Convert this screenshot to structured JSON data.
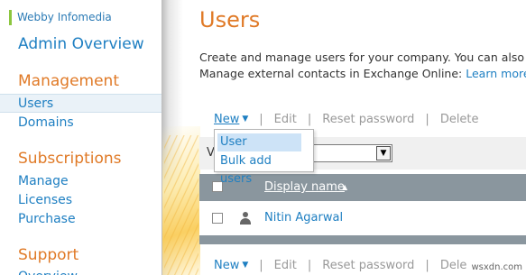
{
  "sidebar": {
    "org_name": "Webby Infomedia",
    "admin_overview": "Admin Overview",
    "sections": [
      {
        "title": "Management",
        "items": [
          "Users",
          "Domains"
        ]
      },
      {
        "title": "Subscriptions",
        "items": [
          "Manage",
          "Licenses",
          "Purchase"
        ]
      },
      {
        "title": "Support",
        "items": [
          "Overview"
        ]
      }
    ],
    "selected_item": "Users"
  },
  "main": {
    "title": "Users",
    "description_line1": "Create and manage users for your company. You can also",
    "description_line2": "Manage external contacts in Exchange Online: ",
    "learn_more": "Learn more",
    "toolbar": {
      "new_label": "New",
      "edit_label": "Edit",
      "reset_password_label": "Reset password",
      "delete_label": "Delete"
    },
    "new_menu": {
      "items": [
        "User",
        "Bulk add users"
      ],
      "active_index": 0
    },
    "view": {
      "label": "V"
    },
    "grid": {
      "columns": [
        "Display name"
      ],
      "sort": "ascending",
      "rows": [
        {
          "display_name": "Nitin Agarwal"
        }
      ]
    },
    "bottom_toolbar": {
      "new_label": "New",
      "edit_label": "Edit",
      "reset_password_label": "Reset password",
      "delete_label": "Dele"
    }
  },
  "watermark": "wsxdn.com",
  "colors": {
    "accent_orange": "#e07a27",
    "link_blue": "#1e7fc2",
    "org_green": "#8cc63f",
    "grid_header": "#8a969e"
  }
}
